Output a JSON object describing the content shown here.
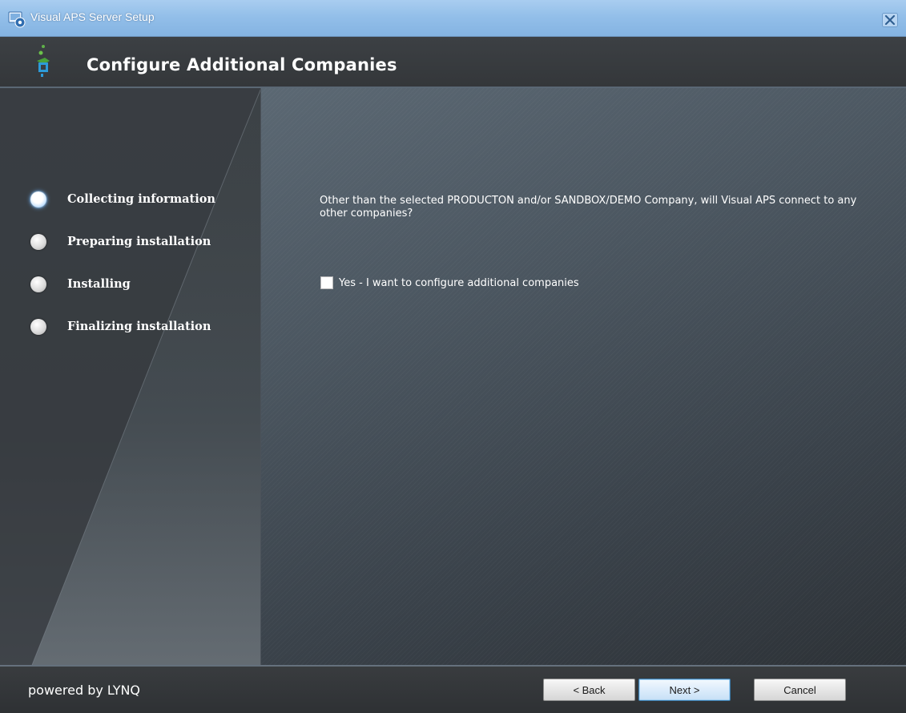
{
  "window": {
    "title": "Visual APS Server Setup"
  },
  "header": {
    "title": "Configure Additional Companies"
  },
  "steps": [
    {
      "label": "Collecting information",
      "active": true
    },
    {
      "label": "Preparing installation",
      "active": false
    },
    {
      "label": "Installing",
      "active": false
    },
    {
      "label": "Finalizing installation",
      "active": false
    }
  ],
  "content": {
    "question": "Other than the selected PRODUCTON and/or SANDBOX/DEMO Company, will Visual APS connect to any other companies?",
    "checkbox_label": "Yes - I want to configure additional companies",
    "checkbox_checked": false
  },
  "footer": {
    "powered_by": "powered by LYNQ",
    "back_label": "< Back",
    "next_label": "Next >",
    "cancel_label": "Cancel"
  },
  "icons": {
    "app": "installer-app-icon",
    "header": "wizard-figure-icon",
    "close": "close-icon"
  },
  "colors": {
    "titlebar": "#93bfe9",
    "active_step_glow": "#6ab4ff",
    "next_button_border": "#3c7fb1"
  }
}
